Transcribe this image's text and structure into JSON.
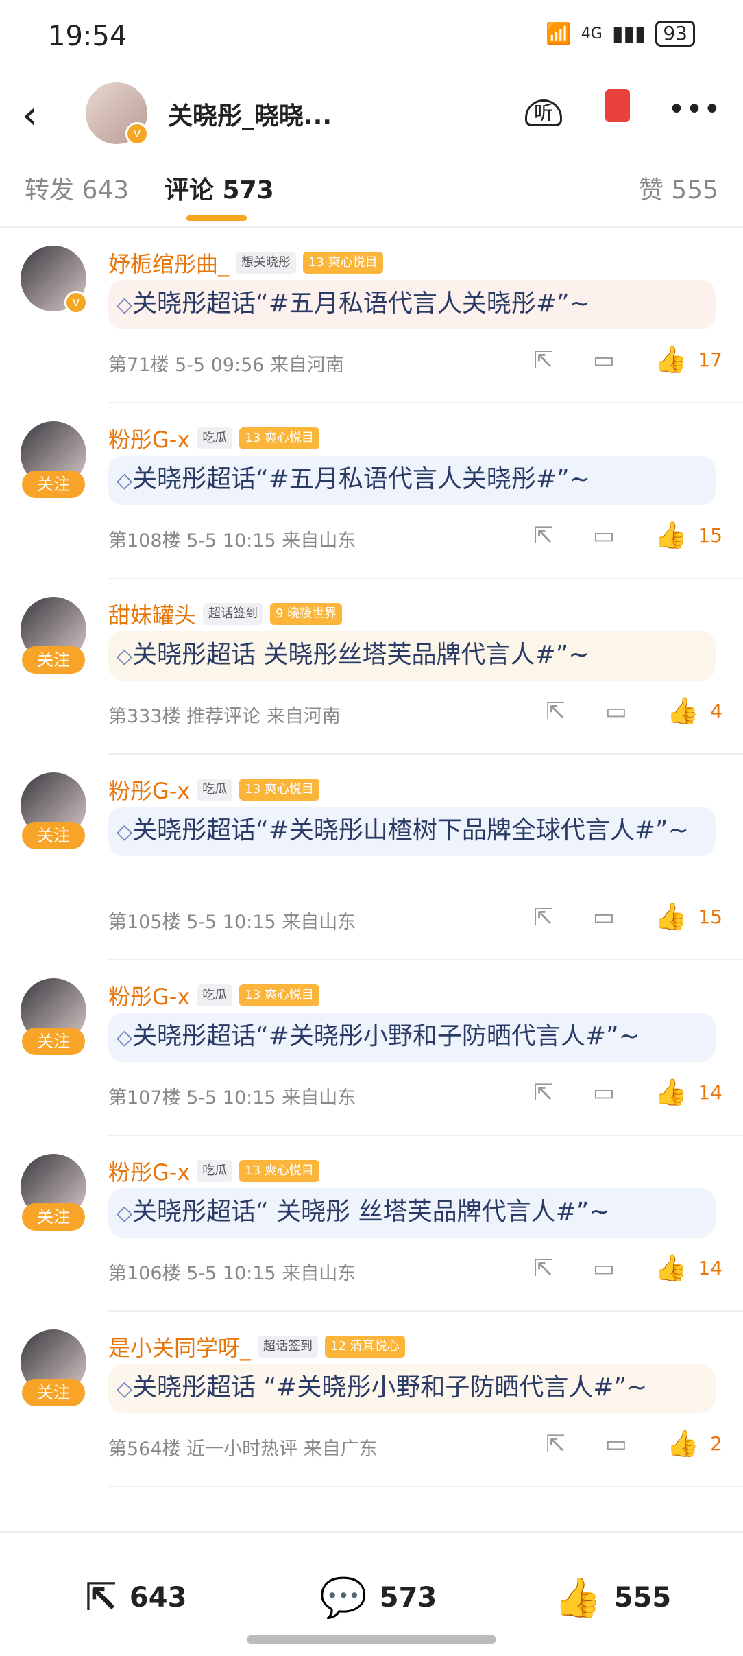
{
  "status_bar": {
    "time": "19:54",
    "network": "4G",
    "battery": "93"
  },
  "header": {
    "title": "关晓彤_晓晓...",
    "listen_label": "听"
  },
  "tabs": [
    {
      "label": "转发 643"
    },
    {
      "label": "评论 573"
    },
    {
      "label": "赞 555"
    }
  ],
  "comments": [
    {
      "name": "妤栀绾彤曲_",
      "badges": [
        "想关晓彤",
        "13 爽心悦目"
      ],
      "text": "关晓彤超话“#五月私语代言人关晓彤#”~",
      "meta": "第71楼 5-5 09:56 来自河南",
      "likes": "17",
      "follow": false
    },
    {
      "name": "粉彤G-x",
      "badges": [
        "吃瓜",
        "13 爽心悦目"
      ],
      "text": "关晓彤超话“#五月私语代言人关晓彤#”~",
      "meta": "第108楼 5-5 10:15 来自山东",
      "likes": "15",
      "follow": true,
      "follow_label": "关注"
    },
    {
      "name": "甜妹罐头",
      "badges": [
        "超话签到",
        "9 晓筱世界"
      ],
      "text": "关晓彤超话 关晓彤丝塔芙品牌代言人#”~",
      "meta": "第333楼 推荐评论 来自河南",
      "likes": "4",
      "follow": true,
      "follow_label": "关注"
    },
    {
      "name": "粉彤G-x",
      "badges": [
        "吃瓜",
        "13 爽心悦目"
      ],
      "text": "关晓彤超话“#关晓彤山楂树下品牌全球代言人#”~",
      "meta": "第105楼 5-5 10:15 来自山东",
      "likes": "15",
      "follow": true,
      "follow_label": "关注"
    },
    {
      "name": "粉彤G-x",
      "badges": [
        "吃瓜",
        "13 爽心悦目"
      ],
      "text": "关晓彤超话“#关晓彤小野和子防晒代言人#”~",
      "meta": "第107楼 5-5 10:15 来自山东",
      "likes": "14",
      "follow": true,
      "follow_label": "关注"
    },
    {
      "name": "粉彤G-x",
      "badges": [
        "吃瓜",
        "13 爽心悦目"
      ],
      "text": "关晓彤超话“ 关晓彤 丝塔芙品牌代言人#”~",
      "meta": "第106楼 5-5 10:15 来自山东",
      "likes": "14",
      "follow": true,
      "follow_label": "关注"
    },
    {
      "name": "是小关同学呀_",
      "badges": [
        "超话签到",
        "12 清耳悦心"
      ],
      "text": "关晓彤超话 “#关晓彤小野和子防晒代言人#”~",
      "meta": "第564楼 近一小时热评 来自广东",
      "likes": "2",
      "follow": true,
      "follow_label": "关注"
    }
  ],
  "footer": {
    "repost_count": "643",
    "comment_count": "573",
    "like_count": "555"
  }
}
